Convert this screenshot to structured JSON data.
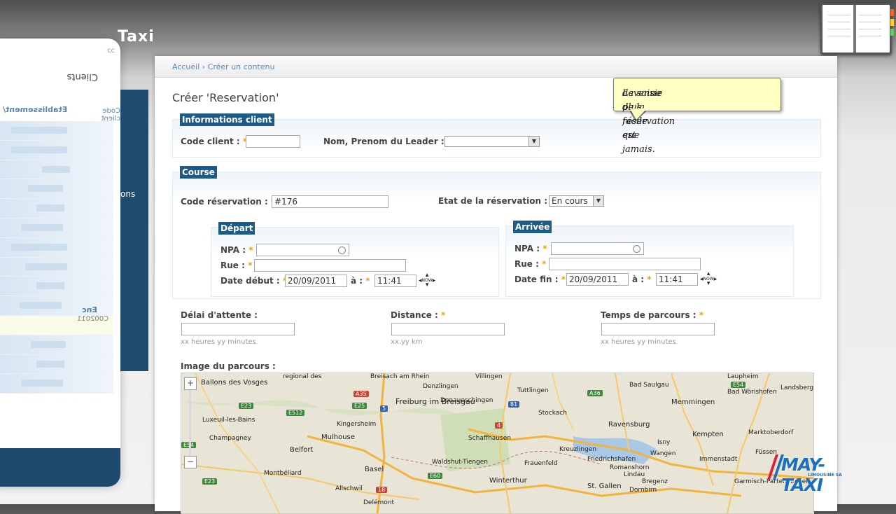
{
  "app": {
    "brand_fragment": "Taxi"
  },
  "side_panel": {
    "header_tab": "cc",
    "title": "Clients",
    "col_head": "Etablissement/",
    "col_head2": "Code client",
    "highlight_code": "C002011",
    "highlight_label": "Enc",
    "partial_text": "ons"
  },
  "breadcrumb": {
    "home": "Accueil",
    "sep": " › ",
    "current": "Créer un contenu"
  },
  "page_title": "Créer 'Reservation'",
  "tooltip": {
    "line1": "La saisie de la réservation est",
    "line2": "devenue plus facile que jamais."
  },
  "client_section": {
    "legend": "Informations client",
    "code_client_label": "Code client :",
    "code_client_value": "",
    "leader_label": "Nom, Prenom du Leader :",
    "leader_value": ""
  },
  "course_section": {
    "legend": "Course",
    "code_res_label": "Code réservation :",
    "code_res_value": "#176",
    "etat_label": "Etat de la réservation :",
    "etat_value": "En cours"
  },
  "depart": {
    "legend": "Départ",
    "npa_label": "NPA :",
    "rue_label": "Rue :",
    "date_label": "Date début :",
    "date_value": "20/09/2011",
    "time_label": "à :",
    "time_value": "11:41",
    "now_label": "NOW"
  },
  "arrivee": {
    "legend": "Arrivée",
    "npa_label": "NPA :",
    "rue_label": "Rue :",
    "date_label": "Date fin :",
    "date_value": "20/09/2011",
    "time_label": "à :",
    "time_value": "11:41",
    "now_label": "NOW"
  },
  "extras": {
    "delai_label": "Délai d'attente :",
    "delai_hint": "xx heures yy minutes",
    "distance_label": "Distance :",
    "distance_hint": "xx.yy km",
    "temps_label": "Temps de parcours :",
    "temps_hint": "xx heures yy minutes"
  },
  "map": {
    "label": "Image du parcours :",
    "zoom_in": "+",
    "zoom_out": "−",
    "cities": [
      "regional des",
      "Ballons des Vosges",
      "Breisach am Rhein",
      "Denzlingen",
      "Villingen",
      "Tuttlingen",
      "Bad Saulgau",
      "Memmingen",
      "Freiburg im Breisgau",
      "Donaueschingen",
      "Stockach",
      "Ravensburg",
      "Kempten",
      "Luxeuil-les-Bains",
      "Kingersheim",
      "Champagney",
      "Mulhouse",
      "Belfort",
      "Schaffhausen",
      "Kreuzlingen",
      "Friedrichshafen",
      "Basel",
      "Waldshut-Tiengen",
      "Frauenfeld",
      "Winterthur",
      "St. Gallen",
      "Bregenz",
      "Montbéliard",
      "Delémont",
      "Immenstadt",
      "Füssen",
      "Landsberg am Lech",
      "Bad Wörishofen",
      "Marktoberdorf",
      "Isny",
      "Wangen",
      "Lindau",
      "Romanshorn",
      "Dornbirn",
      "Garmisch-Partenkirchen",
      "Allschwil",
      "Laupheim"
    ],
    "shields": [
      "A35",
      "E23",
      "E25",
      "E512",
      "5",
      "81",
      "4",
      "A36",
      "E54",
      "E60",
      "18",
      "E23",
      "E54"
    ]
  },
  "logo": {
    "text": "MAY-TAXI",
    "sub": "LIMOUSINE SA"
  }
}
